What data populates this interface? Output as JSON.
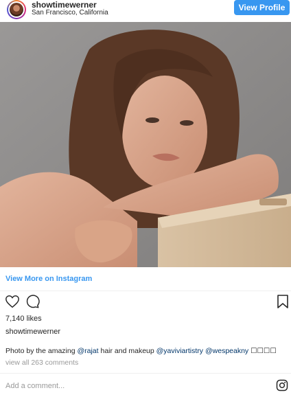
{
  "header": {
    "username": "showtimewerner",
    "location": "San Francisco, California",
    "view_profile_label": "View Profile"
  },
  "post": {
    "view_more_label": "View More on Instagram",
    "likes": "7,140 likes",
    "author": "showtimewerner",
    "caption": {
      "prefix": "Photo by the amazing ",
      "mention1": "@rajat",
      "middle": " hair and makeup ",
      "mention2": "@yaviviartistry",
      "space": " ",
      "mention3": "@wespeakny",
      "suffix": " ☐☐☐☐"
    },
    "view_all_comments": "view all 263 comments",
    "add_comment_placeholder": "Add a comment..."
  },
  "icons": {
    "like": "heart-icon",
    "comment": "comment-icon",
    "save": "bookmark-icon",
    "brand": "instagram-icon"
  },
  "colors": {
    "accent": "#3897f0",
    "mention": "#003569",
    "muted": "#999999"
  }
}
